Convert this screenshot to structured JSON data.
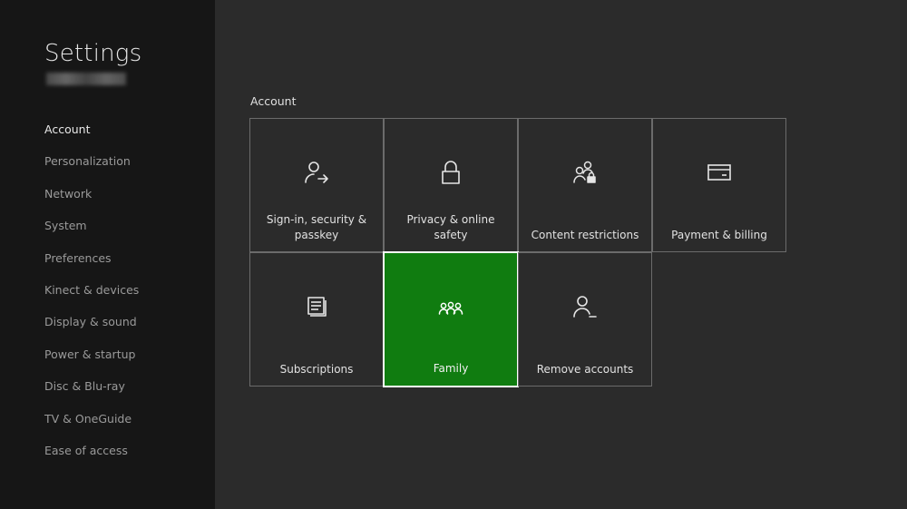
{
  "sidebar": {
    "title": "Settings",
    "items": [
      {
        "label": "Account",
        "active": true
      },
      {
        "label": "Personalization"
      },
      {
        "label": "Network"
      },
      {
        "label": "System"
      },
      {
        "label": "Preferences"
      },
      {
        "label": "Kinect & devices"
      },
      {
        "label": "Display & sound"
      },
      {
        "label": "Power & startup"
      },
      {
        "label": "Disc & Blu-ray"
      },
      {
        "label": "TV & OneGuide"
      },
      {
        "label": "Ease of access"
      }
    ]
  },
  "main": {
    "section_label": "Account",
    "tiles": [
      {
        "label": "Sign-in, security & passkey",
        "icon": "person-arrow-icon"
      },
      {
        "label": "Privacy & online safety",
        "icon": "lock-icon"
      },
      {
        "label": "Content restrictions",
        "icon": "people-lock-icon"
      },
      {
        "label": "Payment & billing",
        "icon": "credit-card-icon"
      },
      {
        "label": "Subscriptions",
        "icon": "document-list-icon"
      },
      {
        "label": "Family",
        "icon": "family-icon",
        "selected": true
      },
      {
        "label": "Remove accounts",
        "icon": "person-minus-icon"
      }
    ]
  },
  "colors": {
    "background": "#2b2b2b",
    "sidebar": "#161616",
    "selected_tile": "#107c10"
  }
}
